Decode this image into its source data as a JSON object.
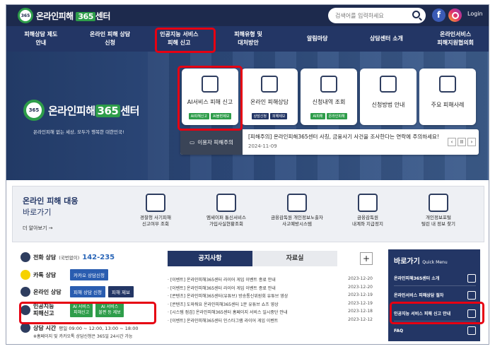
{
  "header": {
    "logo_badge": "365",
    "logo_text": "온라인피해",
    "logo_365": "365",
    "logo_suffix": "센터",
    "search_placeholder": "검색어를 입력하세요",
    "facebook": "f",
    "login": "Login"
  },
  "gnb": [
    {
      "label": "피해상담 제도\n안내"
    },
    {
      "label": "온라인 피해 상담\n신청"
    },
    {
      "label": "인공지능 서비스\n피해 신고"
    },
    {
      "label": "피해유형 및\n대처방안"
    },
    {
      "label": "알림마당"
    },
    {
      "label": "상담센터 소개"
    },
    {
      "label": "온라인서비스\n피해지원협의회"
    }
  ],
  "hero": {
    "logo_text": "온라인피해",
    "logo_365": "365",
    "logo_suffix": "센터",
    "tagline": "온라인피해 없는 세상, 모두가 행복한 대한민국!",
    "cards": [
      {
        "label": "AI서비스 피해 신고",
        "tags": [
          "AI피해신고",
          "AI불편제보"
        ]
      },
      {
        "label": "온라인 피해상담",
        "tags": [
          "상담신청",
          "피해제보"
        ]
      },
      {
        "label": "신청내역 조회",
        "tags": [
          "AI피해",
          "온라인피해"
        ]
      },
      {
        "label": "신청방법 안내",
        "tags": []
      },
      {
        "label": "주요 피해사례",
        "tags": []
      }
    ],
    "notice_label": "이용자 피해주의",
    "notice_text": "[피해주의] 온라인피해365센터 사칭, 금융사기 사건을 조사한다는 연락에 주의하세요!",
    "notice_date": "2024-11-09",
    "ctrl_prev": "‹",
    "ctrl_pause": "II",
    "ctrl_next": "›"
  },
  "quick_band": {
    "title": "온라인 피해 대응",
    "subtitle": "바로가기",
    "more": "더 알아보기 →",
    "items": [
      {
        "label": "경찰청 사기피해\n신고여부 조회"
      },
      {
        "label": "엠세이퍼 통신서비스\n가입사실현황조회"
      },
      {
        "label": "금융감독원 개인정보노출자\n사고예방시스템"
      },
      {
        "label": "금융감독원\n내계좌 지급정지"
      },
      {
        "label": "개인정보포털\n털린 내 정보 찾기"
      }
    ]
  },
  "info": {
    "phone_title": "전화 상담",
    "phone_note": "(국번없이)",
    "phone_number": "142-235",
    "kakao_title": "카톡 상담",
    "kakao_btn": "카카오 상담신청",
    "online_title": "온라인 상담",
    "online_btn1": "피해 상담 신청",
    "online_btn2": "피해 제보",
    "ai_title": "인공지능\n피해신고",
    "ai_btn1": "AI 서비스\n피해신고",
    "ai_btn2": "AI 서비스\n불편 등 제보",
    "hours_title": "상담 시간",
    "hours_text": "평일 09:00 ~ 12:00, 13:00 ~ 18:00",
    "hours_note": "※홈페이지 및 카카오톡 상담신청은 365일 24시간 가능"
  },
  "tabs": {
    "tab1": "공지사항",
    "tab2": "자료실",
    "plus": "+",
    "news": [
      {
        "title": "· [이벤트] 온라인피해365센터 라이어 게임 이벤트 종료 안내",
        "date": "2023-12-20"
      },
      {
        "title": "· [이벤트] 온라인피해365센터 라이어 게임 이벤트 종료 안내",
        "date": "2023-12-20"
      },
      {
        "title": "· [콘텐츠] 온라인피해365센터(유튜브) 방송통신위원회 유튜브 영상",
        "date": "2023-12-19"
      },
      {
        "title": "· [콘텐츠] 도와줘요 온라인피해365센터 1분 유튜브 쇼츠 영상",
        "date": "2023-12-19"
      },
      {
        "title": "· [시스템 점검] 온라인피해365센터 홈페이지 서비스 일시중단 안내",
        "date": "2023-12-18"
      },
      {
        "title": "· [이벤트] 온라인피해365센터 인스타그램 라이어 게임 이벤트",
        "date": "2023-12-12"
      }
    ]
  },
  "quick_menu": {
    "title": "바로가기",
    "title_en": "Quick Menu",
    "items": [
      {
        "label": "온라인피해365센터 소개"
      },
      {
        "label": "온라인서비스 피해상담 절차"
      },
      {
        "label": "인공지능 서비스 피해 신고 안내"
      },
      {
        "label": "FAQ"
      }
    ]
  },
  "colors": {
    "navy": "#233665",
    "green": "#2e9d4a",
    "highlight": "#e60012"
  }
}
